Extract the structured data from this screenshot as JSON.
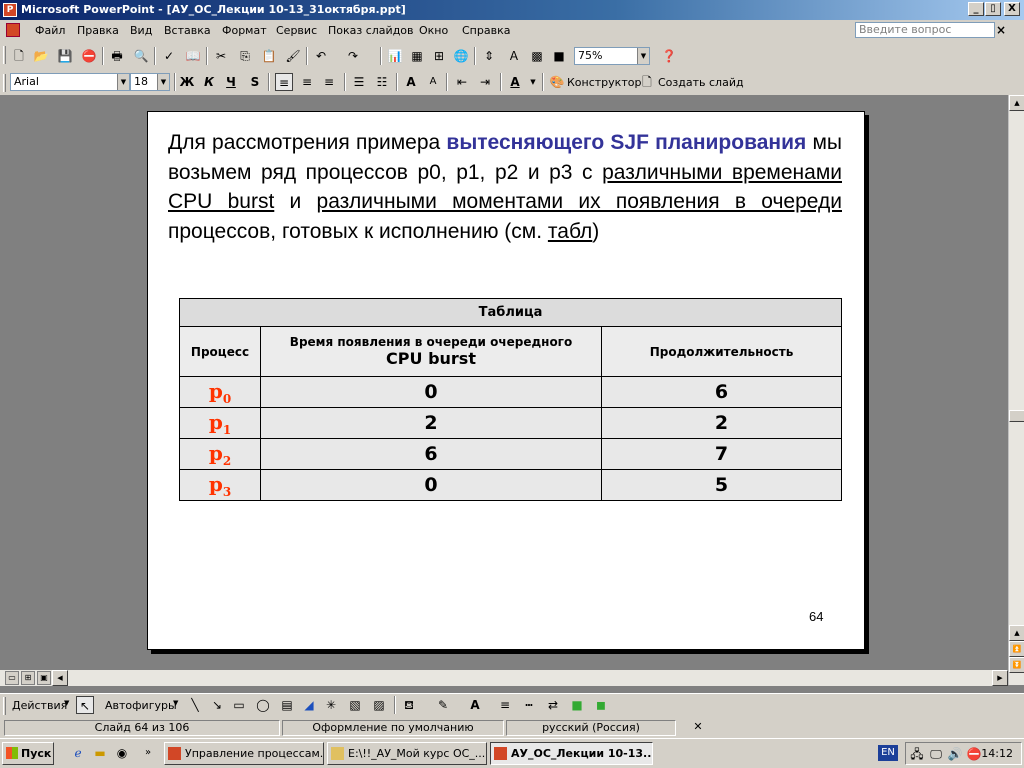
{
  "window": {
    "title": "Microsoft PowerPoint - [АУ_ОС_Лекции 10-13_31октября.ppt]",
    "controls": [
      "_",
      "▯",
      "X"
    ]
  },
  "menu": {
    "items": [
      "Файл",
      "Правка",
      "Вид",
      "Вставка",
      "Формат",
      "Сервис",
      "Показ слайдов",
      "Окно",
      "Справка"
    ],
    "ask_placeholder": "Введите вопрос",
    "close": "×"
  },
  "toolbar1": {
    "zoom": "75%"
  },
  "toolbar2": {
    "font": "Arial",
    "size": "18",
    "bold": "Ж",
    "italic": "К",
    "underline": "Ч",
    "shadow": "S",
    "designer": "Конструктор",
    "new_slide": "Создать слайд"
  },
  "slide": {
    "text_parts": [
      "Для рассмотрения примера ",
      "вытесняющего SJF планирования",
      " мы возьмем ряд процессов p0, p1, p2 и p3 с ",
      "различными временами CPU burst",
      " и ",
      "различными моментами их появления в очереди",
      " процессов, готовых к исполнению (см. ",
      "табл",
      ")"
    ],
    "table": {
      "caption": "Таблица",
      "headers": [
        "Процесс",
        "Время появления в очереди очередного",
        "CPU burst",
        "Продолжительность"
      ],
      "rows": [
        {
          "proc": "p",
          "sub": "0",
          "arrival": "0",
          "duration": "6"
        },
        {
          "proc": "p",
          "sub": "1",
          "arrival": "2",
          "duration": "2"
        },
        {
          "proc": "p",
          "sub": "2",
          "arrival": "6",
          "duration": "7"
        },
        {
          "proc": "p",
          "sub": "3",
          "arrival": "0",
          "duration": "5"
        }
      ]
    },
    "number": "64"
  },
  "drawbar": {
    "actions": "Действия",
    "autoshapes": "Автофигуры"
  },
  "status": {
    "slide": "Слайд 64 из 106",
    "design": "Оформление по умолчанию",
    "language": "русский (Россия)"
  },
  "taskbar": {
    "start": "Пуск",
    "tasks": [
      "Управление процессам...",
      "E:\\!!_АУ_Мой курс ОС_...",
      "АУ_ОС_Лекции 10-13..."
    ],
    "lang": "EN",
    "clock": "14:12"
  }
}
